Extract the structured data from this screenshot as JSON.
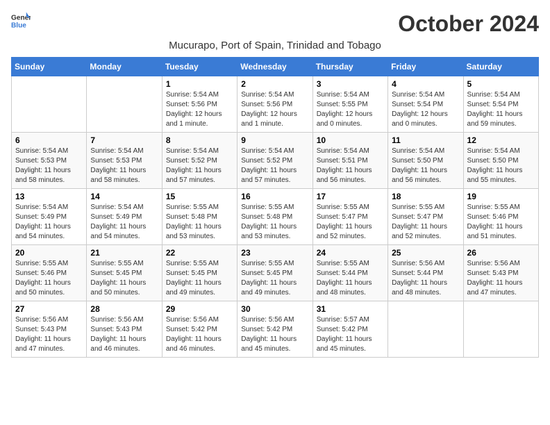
{
  "logo": {
    "text_general": "General",
    "text_blue": "Blue"
  },
  "title": "October 2024",
  "subtitle": "Mucurapo, Port of Spain, Trinidad and Tobago",
  "weekdays": [
    "Sunday",
    "Monday",
    "Tuesday",
    "Wednesday",
    "Thursday",
    "Friday",
    "Saturday"
  ],
  "weeks": [
    [
      null,
      null,
      {
        "day": "1",
        "sunrise": "Sunrise: 5:54 AM",
        "sunset": "Sunset: 5:56 PM",
        "daylight": "Daylight: 12 hours and 1 minute."
      },
      {
        "day": "2",
        "sunrise": "Sunrise: 5:54 AM",
        "sunset": "Sunset: 5:56 PM",
        "daylight": "Daylight: 12 hours and 1 minute."
      },
      {
        "day": "3",
        "sunrise": "Sunrise: 5:54 AM",
        "sunset": "Sunset: 5:55 PM",
        "daylight": "Daylight: 12 hours and 0 minutes."
      },
      {
        "day": "4",
        "sunrise": "Sunrise: 5:54 AM",
        "sunset": "Sunset: 5:54 PM",
        "daylight": "Daylight: 12 hours and 0 minutes."
      },
      {
        "day": "5",
        "sunrise": "Sunrise: 5:54 AM",
        "sunset": "Sunset: 5:54 PM",
        "daylight": "Daylight: 11 hours and 59 minutes."
      }
    ],
    [
      {
        "day": "6",
        "sunrise": "Sunrise: 5:54 AM",
        "sunset": "Sunset: 5:53 PM",
        "daylight": "Daylight: 11 hours and 58 minutes."
      },
      {
        "day": "7",
        "sunrise": "Sunrise: 5:54 AM",
        "sunset": "Sunset: 5:53 PM",
        "daylight": "Daylight: 11 hours and 58 minutes."
      },
      {
        "day": "8",
        "sunrise": "Sunrise: 5:54 AM",
        "sunset": "Sunset: 5:52 PM",
        "daylight": "Daylight: 11 hours and 57 minutes."
      },
      {
        "day": "9",
        "sunrise": "Sunrise: 5:54 AM",
        "sunset": "Sunset: 5:52 PM",
        "daylight": "Daylight: 11 hours and 57 minutes."
      },
      {
        "day": "10",
        "sunrise": "Sunrise: 5:54 AM",
        "sunset": "Sunset: 5:51 PM",
        "daylight": "Daylight: 11 hours and 56 minutes."
      },
      {
        "day": "11",
        "sunrise": "Sunrise: 5:54 AM",
        "sunset": "Sunset: 5:50 PM",
        "daylight": "Daylight: 11 hours and 56 minutes."
      },
      {
        "day": "12",
        "sunrise": "Sunrise: 5:54 AM",
        "sunset": "Sunset: 5:50 PM",
        "daylight": "Daylight: 11 hours and 55 minutes."
      }
    ],
    [
      {
        "day": "13",
        "sunrise": "Sunrise: 5:54 AM",
        "sunset": "Sunset: 5:49 PM",
        "daylight": "Daylight: 11 hours and 54 minutes."
      },
      {
        "day": "14",
        "sunrise": "Sunrise: 5:54 AM",
        "sunset": "Sunset: 5:49 PM",
        "daylight": "Daylight: 11 hours and 54 minutes."
      },
      {
        "day": "15",
        "sunrise": "Sunrise: 5:55 AM",
        "sunset": "Sunset: 5:48 PM",
        "daylight": "Daylight: 11 hours and 53 minutes."
      },
      {
        "day": "16",
        "sunrise": "Sunrise: 5:55 AM",
        "sunset": "Sunset: 5:48 PM",
        "daylight": "Daylight: 11 hours and 53 minutes."
      },
      {
        "day": "17",
        "sunrise": "Sunrise: 5:55 AM",
        "sunset": "Sunset: 5:47 PM",
        "daylight": "Daylight: 11 hours and 52 minutes."
      },
      {
        "day": "18",
        "sunrise": "Sunrise: 5:55 AM",
        "sunset": "Sunset: 5:47 PM",
        "daylight": "Daylight: 11 hours and 52 minutes."
      },
      {
        "day": "19",
        "sunrise": "Sunrise: 5:55 AM",
        "sunset": "Sunset: 5:46 PM",
        "daylight": "Daylight: 11 hours and 51 minutes."
      }
    ],
    [
      {
        "day": "20",
        "sunrise": "Sunrise: 5:55 AM",
        "sunset": "Sunset: 5:46 PM",
        "daylight": "Daylight: 11 hours and 50 minutes."
      },
      {
        "day": "21",
        "sunrise": "Sunrise: 5:55 AM",
        "sunset": "Sunset: 5:45 PM",
        "daylight": "Daylight: 11 hours and 50 minutes."
      },
      {
        "day": "22",
        "sunrise": "Sunrise: 5:55 AM",
        "sunset": "Sunset: 5:45 PM",
        "daylight": "Daylight: 11 hours and 49 minutes."
      },
      {
        "day": "23",
        "sunrise": "Sunrise: 5:55 AM",
        "sunset": "Sunset: 5:45 PM",
        "daylight": "Daylight: 11 hours and 49 minutes."
      },
      {
        "day": "24",
        "sunrise": "Sunrise: 5:55 AM",
        "sunset": "Sunset: 5:44 PM",
        "daylight": "Daylight: 11 hours and 48 minutes."
      },
      {
        "day": "25",
        "sunrise": "Sunrise: 5:56 AM",
        "sunset": "Sunset: 5:44 PM",
        "daylight": "Daylight: 11 hours and 48 minutes."
      },
      {
        "day": "26",
        "sunrise": "Sunrise: 5:56 AM",
        "sunset": "Sunset: 5:43 PM",
        "daylight": "Daylight: 11 hours and 47 minutes."
      }
    ],
    [
      {
        "day": "27",
        "sunrise": "Sunrise: 5:56 AM",
        "sunset": "Sunset: 5:43 PM",
        "daylight": "Daylight: 11 hours and 47 minutes."
      },
      {
        "day": "28",
        "sunrise": "Sunrise: 5:56 AM",
        "sunset": "Sunset: 5:43 PM",
        "daylight": "Daylight: 11 hours and 46 minutes."
      },
      {
        "day": "29",
        "sunrise": "Sunrise: 5:56 AM",
        "sunset": "Sunset: 5:42 PM",
        "daylight": "Daylight: 11 hours and 46 minutes."
      },
      {
        "day": "30",
        "sunrise": "Sunrise: 5:56 AM",
        "sunset": "Sunset: 5:42 PM",
        "daylight": "Daylight: 11 hours and 45 minutes."
      },
      {
        "day": "31",
        "sunrise": "Sunrise: 5:57 AM",
        "sunset": "Sunset: 5:42 PM",
        "daylight": "Daylight: 11 hours and 45 minutes."
      },
      null,
      null
    ]
  ]
}
